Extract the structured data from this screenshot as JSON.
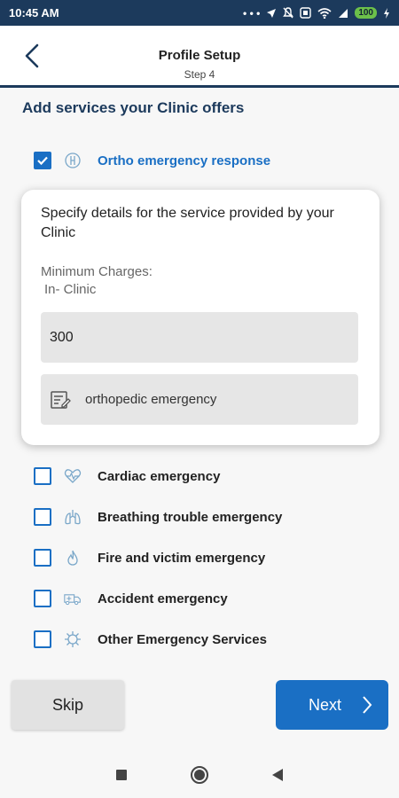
{
  "status_bar": {
    "time": "10:45 AM",
    "dots": "• • •",
    "battery": "100"
  },
  "header": {
    "title": "Profile Setup",
    "subtitle": "Step 4"
  },
  "section_title": "Add services your Clinic offers",
  "selected_service": {
    "label": "Ortho emergency response",
    "checked": true,
    "icon": "ortho-icon"
  },
  "details_card": {
    "heading": "Specify details for the service provided by your Clinic",
    "charges_label": "Minimum Charges:",
    "charges_sublabel": "In- Clinic",
    "charges_value": "300",
    "description_value": "orthopedic emergency"
  },
  "services": [
    {
      "label": "Cardiac emergency",
      "checked": false,
      "icon": "heart-pulse-icon"
    },
    {
      "label": "Breathing trouble emergency",
      "checked": false,
      "icon": "lungs-icon"
    },
    {
      "label": "Fire and victim emergency",
      "checked": false,
      "icon": "fire-icon"
    },
    {
      "label": "Accident emergency",
      "checked": false,
      "icon": "ambulance-icon"
    },
    {
      "label": "Other Emergency Services",
      "checked": false,
      "icon": "virus-icon"
    }
  ],
  "buttons": {
    "skip": "Skip",
    "next": "Next"
  },
  "colors": {
    "primary": "#1a6fc4",
    "header_dark": "#1c3a5c"
  }
}
